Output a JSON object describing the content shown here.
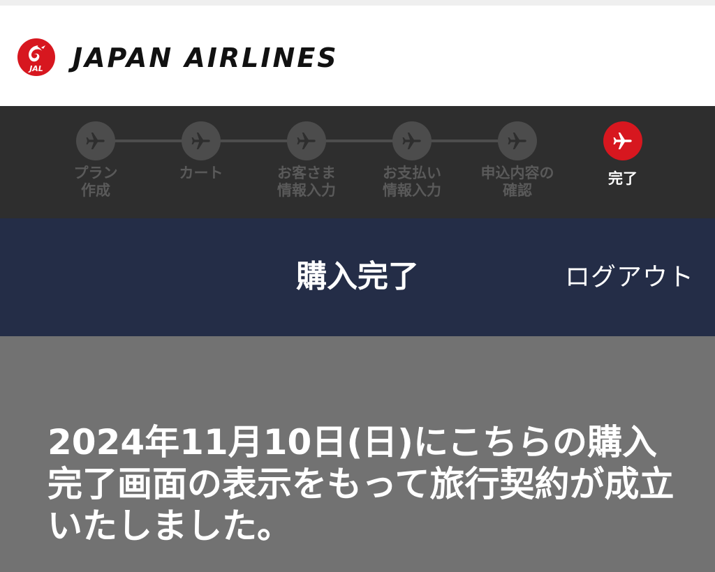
{
  "header": {
    "logo_text": "JAL",
    "brand": "JAPAN AIRLINES",
    "colors": {
      "logo_red": "#d7171f"
    }
  },
  "progress": {
    "steps": [
      {
        "label": "プラン\n作成",
        "icon": "airplane-icon",
        "active": false
      },
      {
        "label": "カート",
        "icon": "airplane-icon",
        "active": false
      },
      {
        "label": "お客さま\n情報入力",
        "icon": "airplane-icon",
        "active": false
      },
      {
        "label": "お支払い\n情報入力",
        "icon": "airplane-icon",
        "active": false
      },
      {
        "label": "申込内容の\n確認",
        "icon": "airplane-icon",
        "active": false
      },
      {
        "label": "完了",
        "icon": "airplane-icon",
        "active": true
      }
    ],
    "colors": {
      "inactive": "#4c4c4c",
      "active": "#d7171f"
    }
  },
  "title_bar": {
    "title": "購入完了",
    "logout_label": "ログアウト",
    "colors": {
      "background": "#242d47"
    }
  },
  "message": {
    "text": "2024年11月10日(日)にこちらの購入完了画面の表示をもって旅行契約が成立いたしました。"
  }
}
